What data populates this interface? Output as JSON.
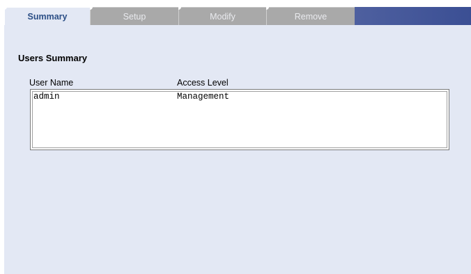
{
  "tabs": [
    {
      "label": "Summary",
      "active": true
    },
    {
      "label": "Setup",
      "active": false
    },
    {
      "label": "Modify",
      "active": false
    },
    {
      "label": "Remove",
      "active": false
    }
  ],
  "section": {
    "title": "Users Summary"
  },
  "table": {
    "columns": [
      "User Name",
      "Access Level"
    ],
    "rows": [
      {
        "user": "admin",
        "access": "Management"
      }
    ]
  },
  "colors": {
    "panel_background": "#e3e8f4",
    "active_tab_text": "#2c4f86",
    "inactive_tab": "#a9a9a9",
    "header_gradient_end": "#3b4f94"
  }
}
